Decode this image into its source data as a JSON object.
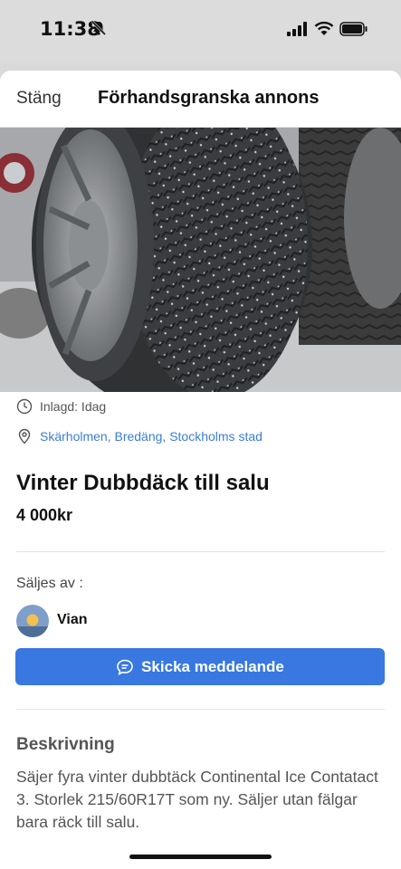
{
  "status_bar": {
    "time": "11:38",
    "icons": [
      "bell-slash-icon",
      "signal-icon",
      "wifi-icon",
      "battery-icon"
    ]
  },
  "header": {
    "close_label": "Stäng",
    "title": "Förhandsgranska annons"
  },
  "gallery": {
    "image_description_icon": "photo-tire-icon",
    "page_count": 3,
    "active_index": 0
  },
  "listing": {
    "posted": "Inlagd: Idag",
    "location": "Skärholmen, Bredäng, Stockholms stad",
    "title": "Vinter Dubbdäck till salu",
    "price": "4 000kr"
  },
  "seller": {
    "label": "Säljes av :",
    "name": "Vian"
  },
  "actions": {
    "message_label": "Skicka meddelande"
  },
  "description": {
    "heading": "Beskrivning",
    "body": "Säjer fyra  vinter dubbtäck Continental Ice Contatact 3.  Storlek 215/60R17T som ny. Säljer utan fälgar bara räck till salu."
  },
  "colors": {
    "accent": "#3878e0",
    "link": "#3b7dd8"
  }
}
